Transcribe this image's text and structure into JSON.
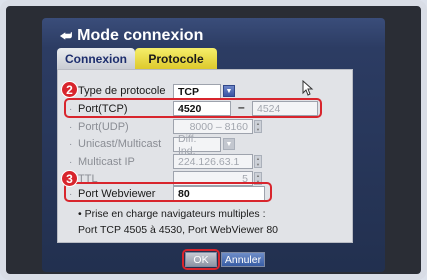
{
  "window": {
    "title": "Mode connexion",
    "title_icon": "login-icon"
  },
  "tabs": [
    {
      "label": "Connexion",
      "active": false
    },
    {
      "label": "Protocole",
      "active": true
    }
  ],
  "fields": {
    "protocol_type": {
      "label": "Type de protocole",
      "value": "TCP"
    },
    "port_tcp": {
      "label": "Port(TCP)",
      "start": "4520",
      "separator": "–",
      "end": "4524"
    },
    "port_udp": {
      "label": "Port(UDP)",
      "value": "8000 – 8160"
    },
    "unicast_multicast": {
      "label": "Unicast/Multicast",
      "value": "Diff. Ind."
    },
    "multicast_ip": {
      "label": "Multicast IP",
      "value": "224.126.63.1"
    },
    "ttl": {
      "label": "TTL",
      "value": "5"
    },
    "port_webviewer": {
      "label": "Port Webviewer",
      "value": "80"
    }
  },
  "note": {
    "line1": "• Prise en charge navigateurs multiples :",
    "line2": "Port TCP 4505 à 4530, Port WebViewer 80"
  },
  "buttons": {
    "ok": "OK",
    "cancel": "Annuler"
  },
  "callouts": {
    "step2": "2",
    "step3": "3"
  },
  "colors": {
    "highlight": "#d8252d",
    "active_tab": "#f0e555",
    "window_bg": "#2c3c63"
  }
}
